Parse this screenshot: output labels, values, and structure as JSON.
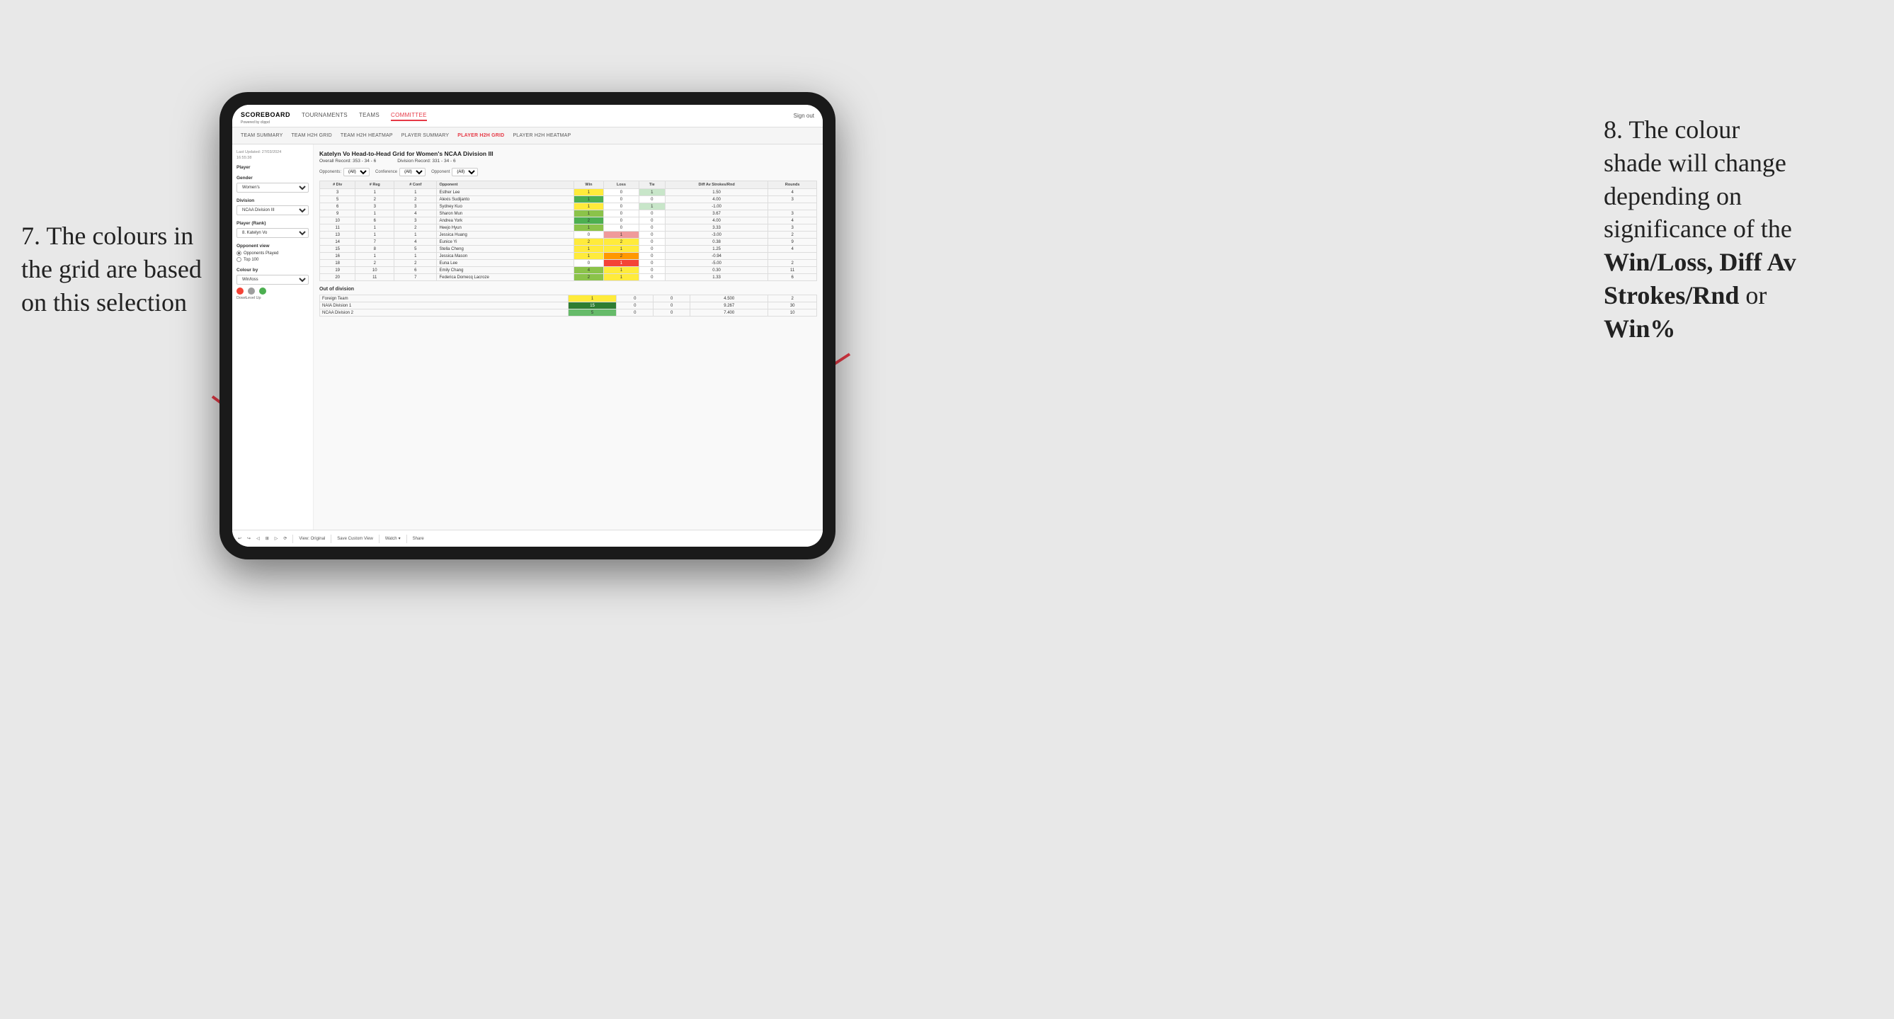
{
  "annotations": {
    "left": {
      "line1": "7. The colours in",
      "line2": "the grid are based",
      "line3": "on this selection"
    },
    "right": {
      "line1": "8. The colour",
      "line2": "shade will change",
      "line3": "depending on",
      "line4": "significance of the",
      "bold1": "Win/Loss,",
      "bold2": "Diff Av",
      "bold3": "Strokes/Rnd",
      "line5": "or",
      "bold4": "Win%"
    }
  },
  "nav": {
    "logo": "SCOREBOARD",
    "logo_sub": "Powered by clippd",
    "items": [
      "TOURNAMENTS",
      "TEAMS",
      "COMMITTEE"
    ],
    "sign_out": "Sign out"
  },
  "sub_nav": {
    "items": [
      "TEAM SUMMARY",
      "TEAM H2H GRID",
      "TEAM H2H HEATMAP",
      "PLAYER SUMMARY",
      "PLAYER H2H GRID",
      "PLAYER H2H HEATMAP"
    ]
  },
  "sidebar": {
    "last_updated_label": "Last Updated: 27/03/2024",
    "last_updated_time": "16:55:38",
    "player_label": "Player",
    "gender_label": "Gender",
    "gender_value": "Women's",
    "division_label": "Division",
    "division_value": "NCAA Division III",
    "player_rank_label": "Player (Rank)",
    "player_rank_value": "8. Katelyn Vo",
    "opponent_view_label": "Opponent view",
    "radio1": "Opponents Played",
    "radio2": "Top 100",
    "colour_by_label": "Colour by",
    "colour_by_value": "Win/loss",
    "colour_down": "Down",
    "colour_level": "Level",
    "colour_up": "Up"
  },
  "main": {
    "title": "Katelyn Vo Head-to-Head Grid for Women's NCAA Division III",
    "overall_record_label": "Overall Record:",
    "overall_record": "353 - 34 - 6",
    "division_record_label": "Division Record:",
    "division_record": "331 - 34 - 6",
    "filter_opponents_label": "Opponents:",
    "filter_opponents_value": "(All)",
    "filter_conference_label": "Conference",
    "filter_conference_value": "(All)",
    "filter_opponent_label": "Opponent",
    "filter_opponent_value": "(All)",
    "col_headers": [
      "#Div",
      "#Reg",
      "#Conf",
      "Opponent",
      "Win",
      "Loss",
      "Tie",
      "Diff Av Strokes/Rnd",
      "Rounds"
    ],
    "rows": [
      {
        "div": "3",
        "reg": "1",
        "conf": "1",
        "opponent": "Esther Lee",
        "win": 1,
        "loss": 0,
        "tie": 1,
        "diff": "1.50",
        "rounds": "4",
        "win_color": "yellow",
        "loss_color": "empty",
        "tie_color": "light-green"
      },
      {
        "div": "5",
        "reg": "2",
        "conf": "2",
        "opponent": "Alexis Sudijanto",
        "win": 1,
        "loss": 0,
        "tie": 0,
        "diff": "4.00",
        "rounds": "3",
        "win_color": "green",
        "loss_color": "empty",
        "tie_color": "empty"
      },
      {
        "div": "6",
        "reg": "3",
        "conf": "3",
        "opponent": "Sydney Kuo",
        "win": 1,
        "loss": 0,
        "tie": 1,
        "diff": "-1.00",
        "rounds": "",
        "win_color": "yellow",
        "loss_color": "empty",
        "tie_color": "light-green"
      },
      {
        "div": "9",
        "reg": "1",
        "conf": "4",
        "opponent": "Sharon Mun",
        "win": 1,
        "loss": 0,
        "tie": 0,
        "diff": "3.67",
        "rounds": "3",
        "win_color": "green-mid",
        "loss_color": "empty",
        "tie_color": "empty"
      },
      {
        "div": "10",
        "reg": "6",
        "conf": "3",
        "opponent": "Andrea York",
        "win": 2,
        "loss": 0,
        "tie": 0,
        "diff": "4.00",
        "rounds": "4",
        "win_color": "green",
        "loss_color": "empty",
        "tie_color": "empty"
      },
      {
        "div": "11",
        "reg": "1",
        "conf": "2",
        "opponent": "Heejo Hyun",
        "win": 1,
        "loss": 0,
        "tie": 0,
        "diff": "3.33",
        "rounds": "3",
        "win_color": "green-mid",
        "loss_color": "empty",
        "tie_color": "empty"
      },
      {
        "div": "13",
        "reg": "1",
        "conf": "1",
        "opponent": "Jessica Huang",
        "win": 0,
        "loss": 1,
        "tie": 0,
        "diff": "-3.00",
        "rounds": "2",
        "win_color": "empty",
        "loss_color": "red-light",
        "tie_color": "empty"
      },
      {
        "div": "14",
        "reg": "7",
        "conf": "4",
        "opponent": "Eunice Yi",
        "win": 2,
        "loss": 2,
        "tie": 0,
        "diff": "0.38",
        "rounds": "9",
        "win_color": "yellow",
        "loss_color": "yellow",
        "tie_color": "empty"
      },
      {
        "div": "15",
        "reg": "8",
        "conf": "5",
        "opponent": "Stella Cheng",
        "win": 1,
        "loss": 1,
        "tie": 0,
        "diff": "1.25",
        "rounds": "4",
        "win_color": "yellow",
        "loss_color": "yellow",
        "tie_color": "empty"
      },
      {
        "div": "16",
        "reg": "1",
        "conf": "1",
        "opponent": "Jessica Mason",
        "win": 1,
        "loss": 2,
        "tie": 0,
        "diff": "-0.94",
        "rounds": "",
        "win_color": "yellow",
        "loss_color": "orange",
        "tie_color": "empty"
      },
      {
        "div": "18",
        "reg": "2",
        "conf": "2",
        "opponent": "Euna Lee",
        "win": 0,
        "loss": 1,
        "tie": 0,
        "diff": "-5.00",
        "rounds": "2",
        "win_color": "empty",
        "loss_color": "red",
        "tie_color": "empty"
      },
      {
        "div": "19",
        "reg": "10",
        "conf": "6",
        "opponent": "Emily Chang",
        "win": 4,
        "loss": 1,
        "tie": 0,
        "diff": "0.30",
        "rounds": "11",
        "win_color": "green-mid",
        "loss_color": "yellow",
        "tie_color": "empty"
      },
      {
        "div": "20",
        "reg": "11",
        "conf": "7",
        "opponent": "Federica Domecq Lacroze",
        "win": 2,
        "loss": 1,
        "tie": 0,
        "diff": "1.33",
        "rounds": "6",
        "win_color": "green-mid",
        "loss_color": "yellow",
        "tie_color": "empty"
      }
    ],
    "out_of_division_label": "Out of division",
    "out_rows": [
      {
        "team": "Foreign Team",
        "win": 1,
        "loss": 0,
        "tie": 0,
        "diff": "4.500",
        "rounds": "2",
        "win_color": "yellow"
      },
      {
        "team": "NAIA Division 1",
        "win": 15,
        "loss": 0,
        "tie": 0,
        "diff": "9.267",
        "rounds": "30",
        "win_color": "dark-green"
      },
      {
        "team": "NCAA Division 2",
        "win": 5,
        "loss": 0,
        "tie": 0,
        "diff": "7.400",
        "rounds": "10",
        "win_color": "med-green"
      }
    ]
  },
  "toolbar": {
    "view_original": "View: Original",
    "save_custom": "Save Custom View",
    "watch": "Watch",
    "share": "Share"
  }
}
